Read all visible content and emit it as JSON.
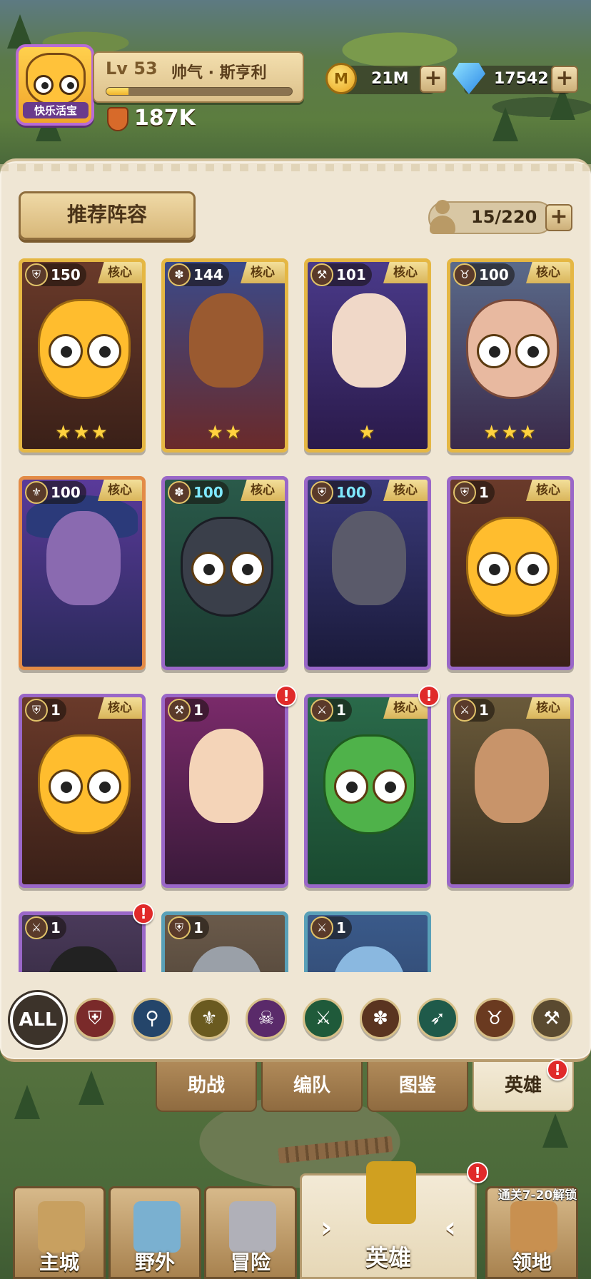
{
  "player": {
    "avatar_name": "快乐活宝",
    "level_label": "Lv 53",
    "name": "帅气 · 斯亨利",
    "xp_fraction": 0.12,
    "power": "187K"
  },
  "resources": {
    "gold": "21M",
    "diamonds": "17542"
  },
  "panel": {
    "recommend_button": "推荐阵容",
    "capacity": "15/220"
  },
  "core_label": "核心",
  "heroes": [
    {
      "level": "150",
      "class_icon": "tank-shield-icon",
      "rarity": "gold",
      "stars": 3,
      "core": true,
      "alert": false,
      "art": "yellow-blob"
    },
    {
      "level": "144",
      "class_icon": "beast-icon",
      "rarity": "gold",
      "stars": 2,
      "core": true,
      "alert": false,
      "art": "monkey-king"
    },
    {
      "level": "101",
      "class_icon": "hammer-icon",
      "rarity": "gold",
      "stars": 1,
      "core": true,
      "alert": false,
      "art": "silver-hair"
    },
    {
      "level": "100",
      "class_icon": "horned-skull-icon",
      "rarity": "gold",
      "stars": 3,
      "core": true,
      "alert": false,
      "art": "pig"
    },
    {
      "level": "100",
      "class_icon": "phoenix-icon",
      "rarity": "orange",
      "stars": 0,
      "core": true,
      "alert": false,
      "art": "witch"
    },
    {
      "level": "100",
      "class_icon": "paw-icon",
      "rarity": "purple",
      "stars": 0,
      "core": true,
      "alert": false,
      "art": "dark-beast"
    },
    {
      "level": "100",
      "class_icon": "tank-shield-icon",
      "rarity": "purple",
      "stars": 0,
      "core": true,
      "alert": false,
      "art": "dark-knight"
    },
    {
      "level": "1",
      "class_icon": "tank-shield-icon",
      "rarity": "purple",
      "stars": 0,
      "core": true,
      "alert": false,
      "art": "yellow-blob"
    },
    {
      "level": "1",
      "class_icon": "tank-shield-icon",
      "rarity": "purple",
      "stars": 0,
      "core": true,
      "alert": false,
      "art": "yellow-blob"
    },
    {
      "level": "1",
      "class_icon": "hammer-icon",
      "rarity": "purple",
      "stars": 0,
      "core": false,
      "alert": true,
      "art": "warrior-girl"
    },
    {
      "level": "1",
      "class_icon": "swords-icon",
      "rarity": "purple",
      "stars": 0,
      "core": true,
      "alert": true,
      "art": "green-goblin"
    },
    {
      "level": "1",
      "class_icon": "swords-icon",
      "rarity": "purple",
      "stars": 0,
      "core": true,
      "alert": false,
      "art": "bald-assassin"
    },
    {
      "level": "1",
      "class_icon": "swords-icon",
      "rarity": "purple",
      "stars": 0,
      "core": false,
      "alert": true,
      "art": "hooded"
    },
    {
      "level": "1",
      "class_icon": "tank-shield-icon",
      "rarity": "teal",
      "stars": 0,
      "core": false,
      "alert": false,
      "art": "robot"
    },
    {
      "level": "1",
      "class_icon": "swords-icon",
      "rarity": "teal",
      "stars": 0,
      "core": false,
      "alert": false,
      "art": "ice"
    }
  ],
  "filters": {
    "all_label": "ALL",
    "icons": [
      {
        "name": "shield-filter-icon",
        "color": "#7a2a2a",
        "glyph": "⛨"
      },
      {
        "name": "staff-filter-icon",
        "color": "#24456a",
        "glyph": "⚲"
      },
      {
        "name": "phoenix-filter-icon",
        "color": "#6a5a20",
        "glyph": "⚜"
      },
      {
        "name": "skull-filter-icon",
        "color": "#5a2a6a",
        "glyph": "☠"
      },
      {
        "name": "swords-filter-icon",
        "color": "#1f5a3a",
        "glyph": "⚔"
      },
      {
        "name": "paw-filter-icon",
        "color": "#5a3420",
        "glyph": "✽"
      },
      {
        "name": "bow-filter-icon",
        "color": "#1f5a4a",
        "glyph": "➶"
      },
      {
        "name": "horned-skull-filter-icon",
        "color": "#6a3a20",
        "glyph": "♉"
      },
      {
        "name": "hammer-filter-icon",
        "color": "#5a4a30",
        "glyph": "⚒"
      }
    ]
  },
  "subtabs": [
    "助战",
    "编队",
    "图鉴",
    "英雄"
  ],
  "active_subtab": "英雄",
  "nav": {
    "items": [
      "主城",
      "野外",
      "冒险",
      "英雄",
      "领地"
    ],
    "active": "英雄",
    "unlock_note": "通关7-20解锁"
  }
}
